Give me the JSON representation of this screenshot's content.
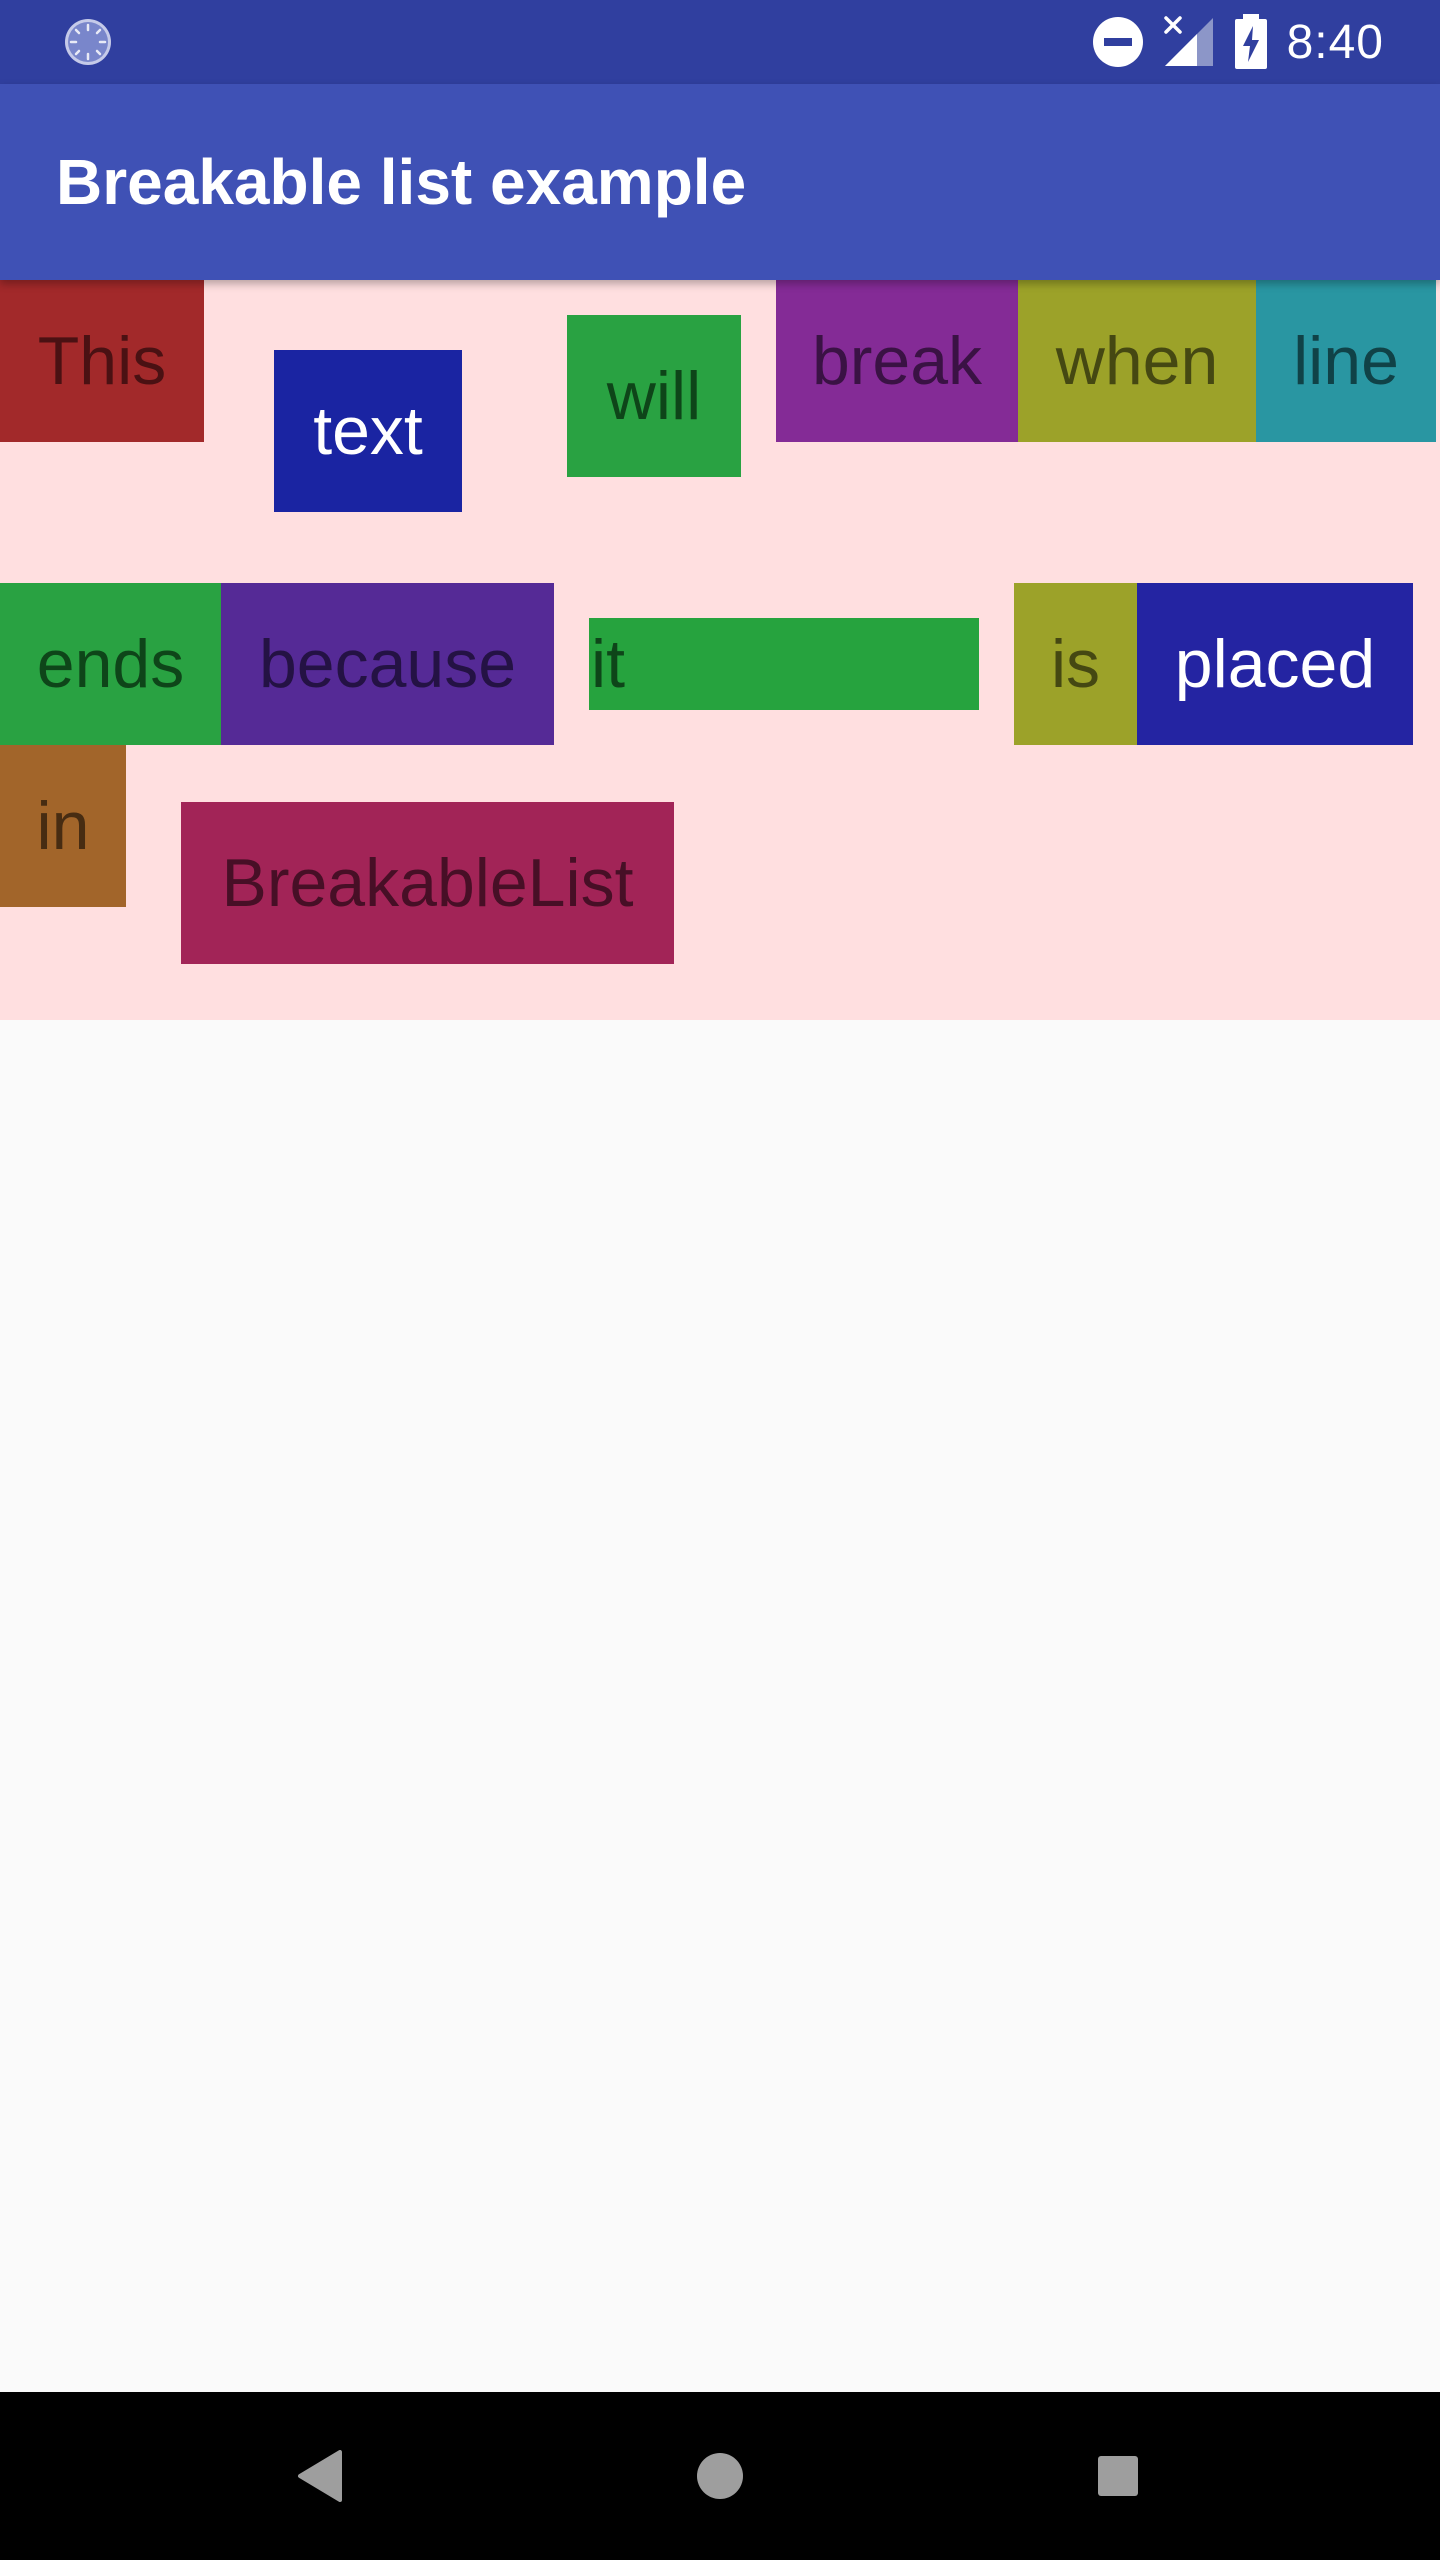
{
  "status_bar": {
    "time": "8:40",
    "icons": [
      "loading-spinner-icon",
      "do-not-disturb-icon",
      "no-signal-icon",
      "battery-charging-icon"
    ]
  },
  "app_bar": {
    "title": "Breakable list example",
    "color": "#3f51b5"
  },
  "breakable_list": {
    "background": "#ffdfe0",
    "items": [
      {
        "text": "This",
        "bg": "#a2292a",
        "fg": "#4a1113"
      },
      {
        "text": "text",
        "bg": "#1a24a2",
        "fg": "#ffffff"
      },
      {
        "text": "will",
        "bg": "#29a242",
        "fg": "#0e4519"
      },
      {
        "text": "break",
        "bg": "#842b96",
        "fg": "#3a1244"
      },
      {
        "text": "when",
        "bg": "#9ca229",
        "fg": "#454812"
      },
      {
        "text": "line",
        "bg": "#2996a2",
        "fg": "#104247"
      },
      {
        "text": "ends",
        "bg": "#29a242",
        "fg": "#0e4519"
      },
      {
        "text": "because",
        "bg": "#552a96",
        "fg": "#241244"
      },
      {
        "text": "it",
        "bg": "#26a33e",
        "fg": "#0e4519"
      },
      {
        "text": "is",
        "bg": "#9ca229",
        "fg": "#454812"
      },
      {
        "text": "placed",
        "bg": "#2424a2",
        "fg": "#ffffff"
      },
      {
        "text": "in",
        "bg": "#a2652a",
        "fg": "#472c12"
      },
      {
        "text": "BreakableList",
        "bg": "#a22457",
        "fg": "#470f26"
      }
    ]
  },
  "nav_bar": {
    "buttons": [
      "back-icon",
      "home-icon",
      "recents-icon"
    ]
  }
}
